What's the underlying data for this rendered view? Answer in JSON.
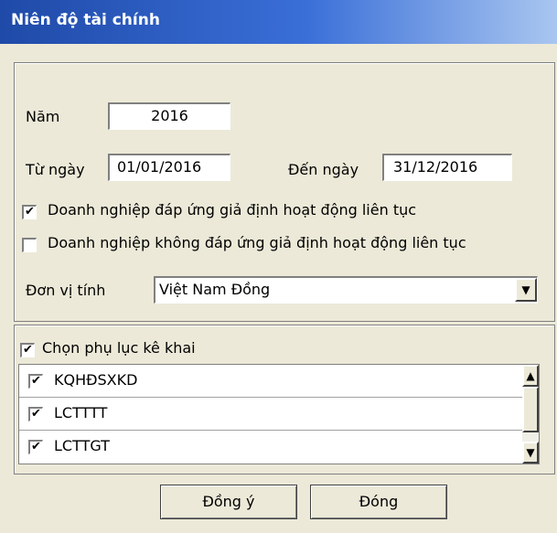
{
  "dialog": {
    "title": "Niên độ tài chính"
  },
  "form": {
    "year_label": "Năm",
    "year_value": "2016",
    "from_label": "Từ ngày",
    "from_value": "01/01/2016",
    "to_label": "Đến ngày",
    "to_value": "31/12/2016",
    "going_concern_label": "Doanh nghiệp đáp ứng giả định hoạt động liên tục",
    "going_concern_checked": true,
    "not_going_concern_label": "Doanh nghiệp không đáp ứng giả định hoạt động liên tục",
    "not_going_concern_checked": false,
    "unit_label": "Đơn vị tính",
    "unit_value": "Việt Nam Đồng"
  },
  "appendix": {
    "select_label": "Chọn phụ lục kê khai",
    "select_checked": true,
    "items": [
      {
        "label": "KQHĐSXKD",
        "checked": true
      },
      {
        "label": "LCTTTT",
        "checked": true
      },
      {
        "label": "LCTTGT",
        "checked": true
      }
    ]
  },
  "buttons": {
    "agree": "Đồng ý",
    "close": "Đóng"
  },
  "icons": {
    "check": "✔",
    "arrow_down": "▼",
    "arrow_up": "▲"
  }
}
